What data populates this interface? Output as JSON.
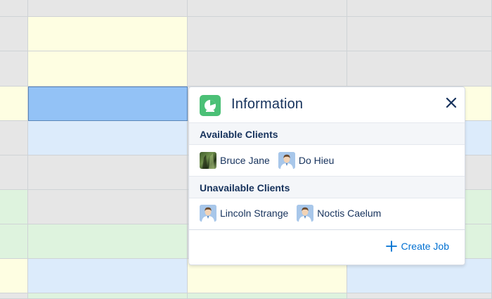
{
  "popover": {
    "title": "Information",
    "icon": "report-icon",
    "close_icon": "close-icon",
    "available_title": "Available Clients",
    "available_clients": [
      {
        "name": "Bruce Jane",
        "avatar": "photo"
      },
      {
        "name": "Do Hieu",
        "avatar": "generic-person"
      }
    ],
    "unavailable_title": "Unavailable Clients",
    "unavailable_clients": [
      {
        "name": "Lincoln Strange",
        "avatar": "generic-person"
      },
      {
        "name": "Noctis Caelum",
        "avatar": "generic-person"
      }
    ],
    "action_label": "Create Job",
    "action_icon": "plus-icon"
  },
  "colors": {
    "brand_icon_bg": "#4bc076",
    "title_text": "#16325c",
    "link": "#0070d2",
    "cell_gray": "#e6e6e6",
    "cell_yellow": "#fefee2",
    "cell_blue": "#dcebfb",
    "cell_green": "#def3de",
    "cell_selected": "#93c2f6"
  }
}
